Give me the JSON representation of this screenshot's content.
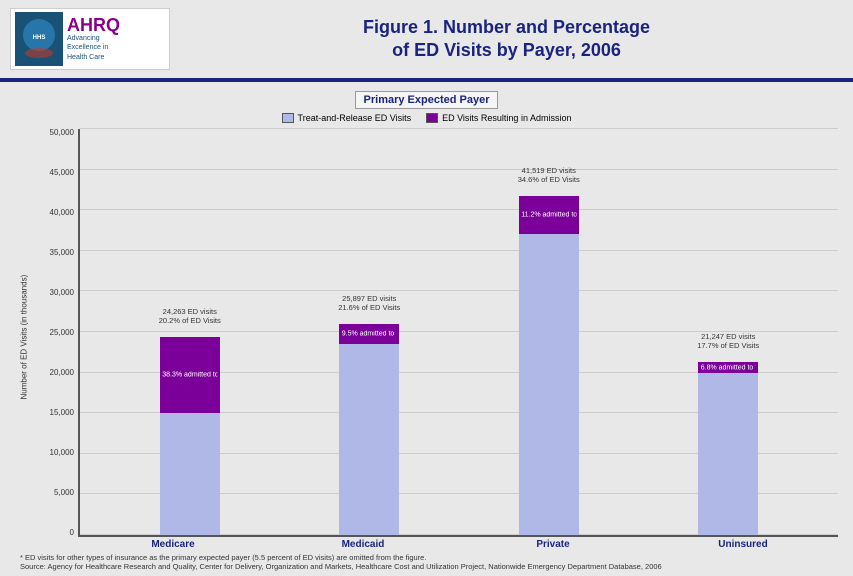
{
  "header": {
    "title_line1": "Figure 1. Number and Percentage",
    "title_line2": "of ED Visits by Payer, 2006"
  },
  "ahrq": {
    "name": "AHRQ",
    "subtitle_line1": "Advancing",
    "subtitle_line2": "Excellence in",
    "subtitle_line3": "Health Care"
  },
  "chart": {
    "primary_payer_label": "Primary Expected Payer",
    "legend": [
      {
        "label": "Treat-and-Release ED Visits",
        "color": "#b0b8e8"
      },
      {
        "label": "ED Visits Resulting in Admission",
        "color": "#7b0099"
      }
    ],
    "y_axis_label": "Number of ED Visits (in thousands)",
    "y_ticks": [
      "50,000",
      "45,000",
      "40,000",
      "35,000",
      "30,000",
      "25,000",
      "20,000",
      "15,000",
      "10,000",
      "5,000",
      "0"
    ],
    "bars": [
      {
        "label": "Medicare",
        "total_label": "24,263 ED visits",
        "pct_label": "20.2% of ED Visits",
        "admit_pct": "38.3%",
        "admit_text": "admitted to the hospital",
        "total_height_pct": 48.5,
        "admit_height_pct": 18.6
      },
      {
        "label": "Medicaid",
        "total_label": "25,897 ED visits",
        "pct_label": "21.6% of ED Visits",
        "admit_pct": "9.5%",
        "admit_text": "admitted to the hospital",
        "total_height_pct": 51.8,
        "admit_height_pct": 4.9
      },
      {
        "label": "Private",
        "total_label": "41,519 ED visits",
        "pct_label": "34.6% of ED Visits",
        "admit_pct": "11.2%",
        "admit_text": "admitted to the hospital",
        "total_height_pct": 83.0,
        "admit_height_pct": 9.3
      },
      {
        "label": "Uninsured",
        "total_label": "21,247 ED visits",
        "pct_label": "17.7% of ED Visits",
        "admit_pct": "6.8%",
        "admit_text": "admitted to the hospital",
        "total_height_pct": 42.5,
        "admit_height_pct": 2.9
      }
    ],
    "footnote1": "* ED visits for other types of insurance as the primary expected payer (5.5 percent of ED visits) are omitted from the figure.",
    "footnote2": "Source: Agency for Healthcare Research and Quality, Center for Delivery, Organization and Markets, Healthcare Cost and Utilization Project, Nationwide Emergency Department Database, 2006"
  }
}
